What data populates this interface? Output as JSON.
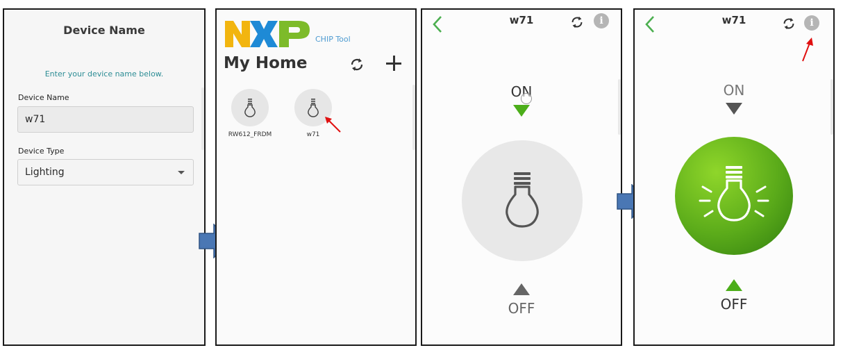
{
  "colors": {
    "accent_green": "#4cae1a",
    "hint_teal": "#2d8d95",
    "chip_blue": "#4e9bd1",
    "arrow_blue": "#4a77b4",
    "annotation_red": "#e01010"
  },
  "panel1": {
    "title": "Device Name",
    "hint": "Enter your device name below.",
    "name_label": "Device Name",
    "name_value": "w71",
    "type_label": "Device Type",
    "type_value": "Lighting"
  },
  "panel2": {
    "brand_logo": "NXP",
    "brand_subtitle": "CHIP Tool",
    "title": "My Home",
    "devices": [
      {
        "name": "RW612_FRDM",
        "icon": "bulb-icon"
      },
      {
        "name": "w71",
        "icon": "bulb-icon"
      }
    ]
  },
  "panel3": {
    "device": "w71",
    "on_label": "ON",
    "off_label": "OFF",
    "state": "off"
  },
  "panel4": {
    "device": "w71",
    "on_label": "ON",
    "off_label": "OFF",
    "state": "on"
  }
}
